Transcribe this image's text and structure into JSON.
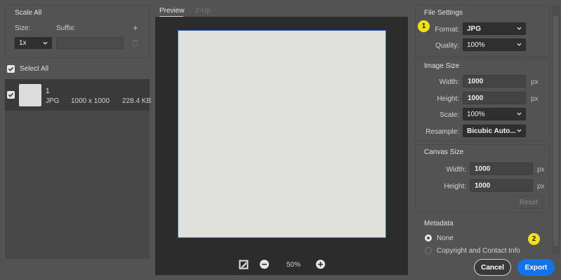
{
  "scale_panel": {
    "title": "Scale All",
    "size_label": "Size:",
    "suffix_label": "Suffix:",
    "add_symbol": "+",
    "size_value": "1x",
    "suffix_value": ""
  },
  "select_all_label": "Select All",
  "assets": [
    {
      "name": "1",
      "format": "JPG",
      "dimensions": "1000 x 1000",
      "file_size": "228.4 KB"
    }
  ],
  "preview": {
    "tabs": [
      "Preview",
      "2-Up"
    ],
    "zoom_level": "50%"
  },
  "file_settings": {
    "title": "File Settings",
    "format_label": "Format:",
    "format_value": "JPG",
    "quality_label": "Quality:",
    "quality_value": "100%"
  },
  "image_size": {
    "title": "Image Size",
    "width_label": "Width:",
    "width_value": "1000",
    "height_label": "Height:",
    "height_value": "1000",
    "unit": "px",
    "scale_label": "Scale:",
    "scale_value": "100%",
    "resample_label": "Resample:",
    "resample_value": "Bicubic Auto..."
  },
  "canvas_size": {
    "title": "Canvas Size",
    "width_label": "Width:",
    "width_value": "1000",
    "height_label": "Height:",
    "height_value": "1000",
    "unit": "px",
    "reset_label": "Reset"
  },
  "metadata": {
    "title": "Metadata",
    "options": [
      "None",
      "Copyright and Contact Info"
    ],
    "selected": "None"
  },
  "annotations": [
    "1",
    "2"
  ],
  "buttons": {
    "cancel": "Cancel",
    "export": "Export"
  },
  "colors": {
    "background": "#535353",
    "accent": "#1473e6",
    "badge": "#f2e11a",
    "selection_border": "#3a6ed4"
  }
}
